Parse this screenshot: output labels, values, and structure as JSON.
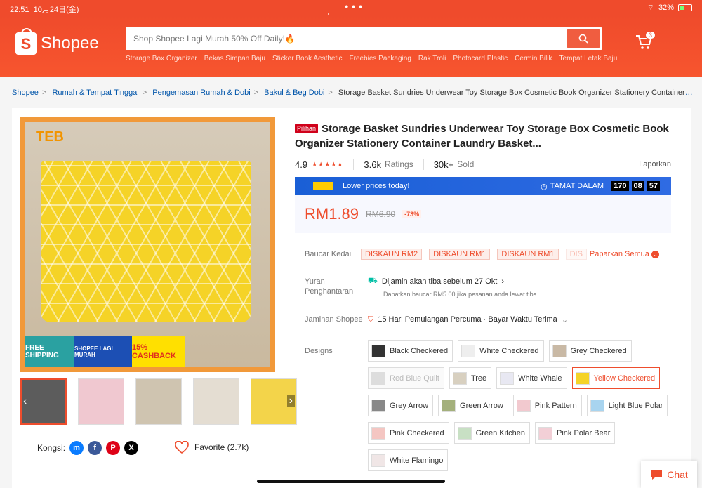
{
  "status": {
    "time": "22:51",
    "date": "10月24日(金)",
    "battery": "32%"
  },
  "browser": {
    "url": "shopee.com.my"
  },
  "header": {
    "logo": "Shopee",
    "search_placeholder": "Shop Shopee Lagi Murah 50% Off Daily!🔥",
    "cart_count": "3",
    "suggestions": [
      "Storage Box Organizer",
      "Bekas Simpan Baju",
      "Sticker Book Aesthetic",
      "Freebies Packaging",
      "Rak Troli",
      "Photocard Plastic",
      "Cermin Bilik",
      "Tempat Letak Baju"
    ]
  },
  "breadcrumb": [
    "Shopee",
    "Rumah & Tempat Tinggal",
    "Pengemasan Rumah & Dobi",
    "Bakul & Beg Dobi",
    "Storage Basket Sundries Underwear Toy Storage Box Cosmetic Book Organizer Stationery Container Laund..."
  ],
  "gallery": {
    "brand": "TEB",
    "promo": [
      "FREE SHIPPING",
      "SHOPEE LAGI MURAH",
      "15% CASHBACK"
    ]
  },
  "share": {
    "label": "Kongsi:",
    "favorite": "Favorite (2.7k)"
  },
  "product": {
    "badge": "Pilihan",
    "title": "Storage Basket Sundries Underwear Toy Storage Box Cosmetic Book Organizer Stationery Container Laundry Basket...",
    "rating": "4.9",
    "ratings_count": "3.6k",
    "ratings_label": "Ratings",
    "sold_count": "30k+",
    "sold_label": "Sold",
    "report": "Laporkan",
    "flash_text": "Lower prices today!",
    "ends_label": "TAMAT DALAM",
    "timer": [
      "170",
      "08",
      "57"
    ],
    "price": "RM1.89",
    "old_price": "RM6.90",
    "discount": "-73%"
  },
  "vouchers": {
    "label": "Baucar Kedai",
    "items": [
      "DISKAUN RM2",
      "DISKAUN RM1",
      "DISKAUN RM1",
      "DIS"
    ],
    "see_all": "Paparkan Semua"
  },
  "shipping": {
    "label": "Yuran Penghantaran",
    "line": "Dijamin akan tiba sebelum 27 Okt",
    "sub": "Dapatkan baucar RM5.00 jika pesanan anda lewat tiba"
  },
  "guarantee": {
    "label": "Jaminan Shopee",
    "text": "15 Hari Pemulangan Percuma · Bayar Waktu Terima"
  },
  "designs": {
    "label": "Designs",
    "options": [
      {
        "name": "Black Checkered",
        "color": "#333333"
      },
      {
        "name": "White Checkered",
        "color": "#eeeeee"
      },
      {
        "name": "Grey Checkered",
        "color": "#c9b9a5"
      },
      {
        "name": "Red Blue Quilt",
        "color": "#dddddd",
        "disabled": true
      },
      {
        "name": "Tree",
        "color": "#d8d0c0"
      },
      {
        "name": "White Whale",
        "color": "#e8e8f2"
      },
      {
        "name": "Yellow Checkered",
        "color": "#f5d327",
        "selected": true
      },
      {
        "name": "Grey Arrow",
        "color": "#888888"
      },
      {
        "name": "Green Arrow",
        "color": "#a4b07c"
      },
      {
        "name": "Pink Pattern",
        "color": "#f2c9cf"
      },
      {
        "name": "Light Blue Polar",
        "color": "#a8d4ef"
      },
      {
        "name": "Pink Checkered",
        "color": "#f4c6c2"
      },
      {
        "name": "Green Kitchen",
        "color": "#c8e0c4"
      },
      {
        "name": "Pink Polar Bear",
        "color": "#f2cfd6"
      },
      {
        "name": "White Flamingo",
        "color": "#f0e6e6"
      }
    ]
  },
  "chat": "Chat"
}
